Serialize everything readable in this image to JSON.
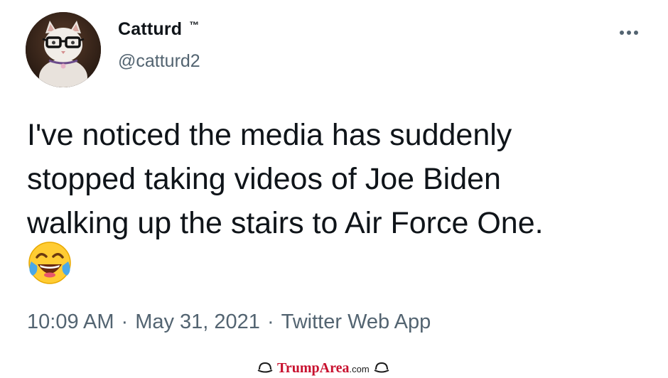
{
  "tweet": {
    "display_name": "Catturd",
    "trademark": "™",
    "handle": "@catturd2",
    "more_icon": "more-horizontal-icon",
    "text": "I've noticed the media has suddenly\nstopped taking videos of Joe Biden\nwalking up the stairs to Air Force One.",
    "emoji": "face-with-tears-of-joy",
    "time": "10:09 AM",
    "separator": "·",
    "date": "May 31, 2021",
    "source": "Twitter Web App"
  },
  "watermark": {
    "brand": "TrumpArea",
    "suffix": ".com"
  },
  "colors": {
    "text_primary": "#0f1419",
    "text_secondary": "#536471",
    "watermark_red": "#c8102e"
  }
}
